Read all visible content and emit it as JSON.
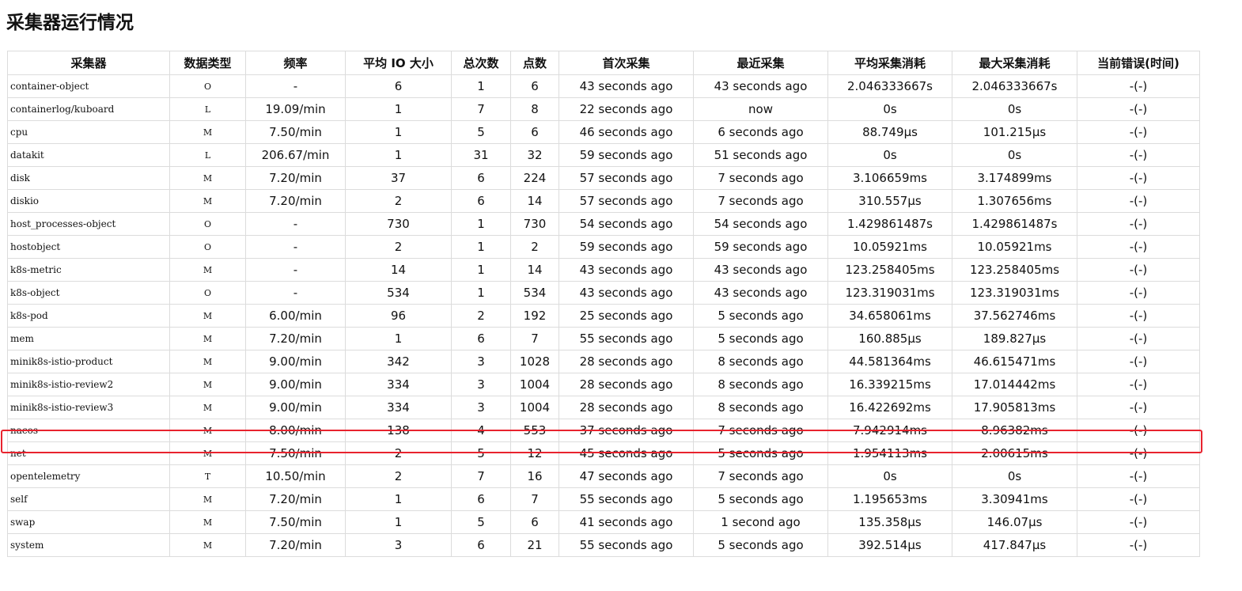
{
  "page": {
    "title": "采集器运行情况"
  },
  "table": {
    "headers": [
      "采集器",
      "数据类型",
      "频率",
      "平均 IO 大小",
      "总次数",
      "点数",
      "首次采集",
      "最近采集",
      "平均采集消耗",
      "最大采集消耗",
      "当前错误(时间)"
    ],
    "rows": [
      [
        "container-object",
        "O",
        "-",
        "6",
        "1",
        "6",
        "43 seconds ago",
        "43 seconds ago",
        "2.046333667s",
        "2.046333667s",
        "-(-)"
      ],
      [
        "containerlog/kuboard",
        "L",
        "19.09/min",
        "1",
        "7",
        "8",
        "22 seconds ago",
        "now",
        "0s",
        "0s",
        "-(-)"
      ],
      [
        "cpu",
        "M",
        "7.50/min",
        "1",
        "5",
        "6",
        "46 seconds ago",
        "6 seconds ago",
        "88.749µs",
        "101.215µs",
        "-(-)"
      ],
      [
        "datakit",
        "L",
        "206.67/min",
        "1",
        "31",
        "32",
        "59 seconds ago",
        "51 seconds ago",
        "0s",
        "0s",
        "-(-)"
      ],
      [
        "disk",
        "M",
        "7.20/min",
        "37",
        "6",
        "224",
        "57 seconds ago",
        "7 seconds ago",
        "3.106659ms",
        "3.174899ms",
        "-(-)"
      ],
      [
        "diskio",
        "M",
        "7.20/min",
        "2",
        "6",
        "14",
        "57 seconds ago",
        "7 seconds ago",
        "310.557µs",
        "1.307656ms",
        "-(-)"
      ],
      [
        "host_processes-object",
        "O",
        "-",
        "730",
        "1",
        "730",
        "54 seconds ago",
        "54 seconds ago",
        "1.429861487s",
        "1.429861487s",
        "-(-)"
      ],
      [
        "hostobject",
        "O",
        "-",
        "2",
        "1",
        "2",
        "59 seconds ago",
        "59 seconds ago",
        "10.05921ms",
        "10.05921ms",
        "-(-)"
      ],
      [
        "k8s-metric",
        "M",
        "-",
        "14",
        "1",
        "14",
        "43 seconds ago",
        "43 seconds ago",
        "123.258405ms",
        "123.258405ms",
        "-(-)"
      ],
      [
        "k8s-object",
        "O",
        "-",
        "534",
        "1",
        "534",
        "43 seconds ago",
        "43 seconds ago",
        "123.319031ms",
        "123.319031ms",
        "-(-)"
      ],
      [
        "k8s-pod",
        "M",
        "6.00/min",
        "96",
        "2",
        "192",
        "25 seconds ago",
        "5 seconds ago",
        "34.658061ms",
        "37.562746ms",
        "-(-)"
      ],
      [
        "mem",
        "M",
        "7.20/min",
        "1",
        "6",
        "7",
        "55 seconds ago",
        "5 seconds ago",
        "160.885µs",
        "189.827µs",
        "-(-)"
      ],
      [
        "minik8s-istio-product",
        "M",
        "9.00/min",
        "342",
        "3",
        "1028",
        "28 seconds ago",
        "8 seconds ago",
        "44.581364ms",
        "46.615471ms",
        "-(-)"
      ],
      [
        "minik8s-istio-review2",
        "M",
        "9.00/min",
        "334",
        "3",
        "1004",
        "28 seconds ago",
        "8 seconds ago",
        "16.339215ms",
        "17.014442ms",
        "-(-)"
      ],
      [
        "minik8s-istio-review3",
        "M",
        "9.00/min",
        "334",
        "3",
        "1004",
        "28 seconds ago",
        "8 seconds ago",
        "16.422692ms",
        "17.905813ms",
        "-(-)"
      ],
      [
        "nacos",
        "M",
        "8.00/min",
        "138",
        "4",
        "553",
        "37 seconds ago",
        "7 seconds ago",
        "7.942914ms",
        "8.96382ms",
        "-(-)"
      ],
      [
        "net",
        "M",
        "7.50/min",
        "2",
        "5",
        "12",
        "45 seconds ago",
        "5 seconds ago",
        "1.954113ms",
        "2.00615ms",
        "-(-)"
      ],
      [
        "opentelemetry",
        "T",
        "10.50/min",
        "2",
        "7",
        "16",
        "47 seconds ago",
        "7 seconds ago",
        "0s",
        "0s",
        "-(-)"
      ],
      [
        "self",
        "M",
        "7.20/min",
        "1",
        "6",
        "7",
        "55 seconds ago",
        "5 seconds ago",
        "1.195653ms",
        "3.30941ms",
        "-(-)"
      ],
      [
        "swap",
        "M",
        "7.50/min",
        "1",
        "5",
        "6",
        "41 seconds ago",
        "1 second ago",
        "135.358µs",
        "146.07µs",
        "-(-)"
      ],
      [
        "system",
        "M",
        "7.20/min",
        "3",
        "6",
        "21",
        "55 seconds ago",
        "5 seconds ago",
        "392.514µs",
        "417.847µs",
        "-(-)"
      ]
    ],
    "highlighted_row": "nacos",
    "highlight_color": "#e8232e"
  }
}
